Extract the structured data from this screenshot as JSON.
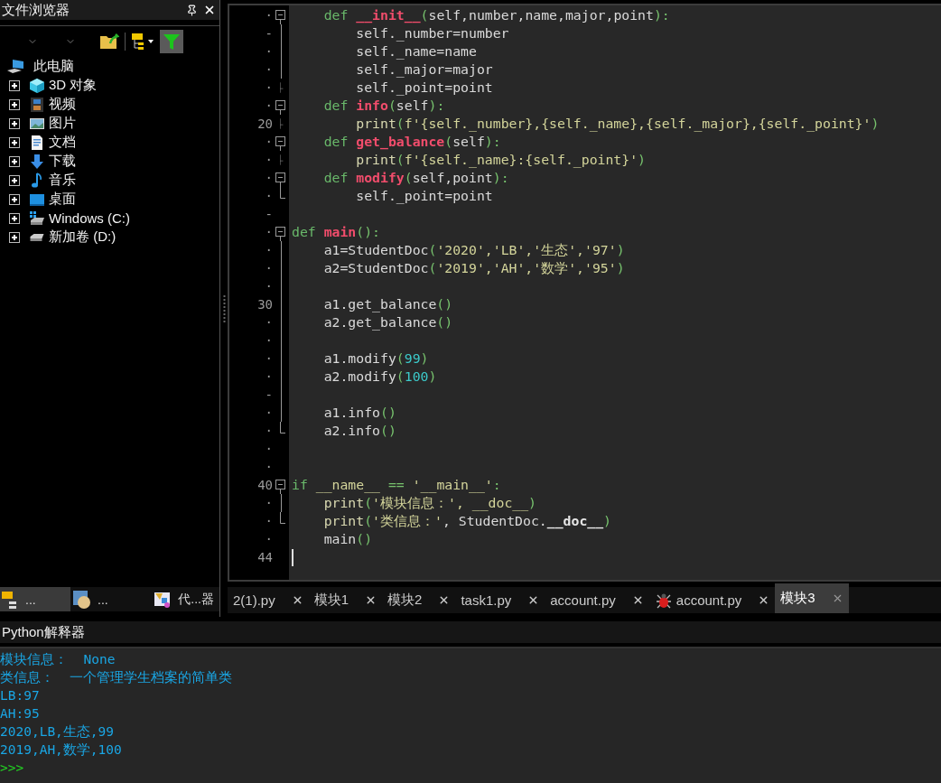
{
  "explorer": {
    "title": "文件浏览器",
    "toolbar": {
      "filter_active": true
    },
    "tree": {
      "label": "此电脑",
      "children": [
        {
          "label": "3D 对象",
          "kind": "cube",
          "expanded": false
        },
        {
          "label": "视频",
          "kind": "video",
          "expanded": false
        },
        {
          "label": "图片",
          "kind": "picture",
          "expanded": false
        },
        {
          "label": "文档",
          "kind": "document",
          "expanded": false
        },
        {
          "label": "下载",
          "kind": "download",
          "expanded": false
        },
        {
          "label": "音乐",
          "kind": "music",
          "expanded": false
        },
        {
          "label": "桌面",
          "kind": "desktop",
          "expanded": false
        },
        {
          "label": "Windows (C:)",
          "kind": "system-drive",
          "expanded": false
        },
        {
          "label": "新加卷 (D:)",
          "kind": "drive",
          "expanded": false
        }
      ]
    },
    "tabs": [
      {
        "label": "...",
        "kind": "files",
        "selected": true
      },
      {
        "label": "...",
        "kind": "classes",
        "selected": false
      },
      {
        "label": "代...器",
        "kind": "code",
        "selected": false
      }
    ]
  },
  "editor": {
    "lines": [
      {
        "gutter": "·",
        "kind": "open",
        "tokens": [
          {
            "kind": "kw",
            "text": "    def "
          },
          {
            "kind": "fn",
            "text": "__init__"
          },
          {
            "kind": "punct",
            "text": "("
          },
          {
            "kind": "text",
            "text": "self,number,name,major,point"
          },
          {
            "kind": "punct",
            "text": "):"
          }
        ]
      },
      {
        "gutter": "-",
        "kind": "line",
        "tokens": [
          {
            "kind": "text",
            "text": "        self._number=number"
          }
        ]
      },
      {
        "gutter": "·",
        "kind": "line",
        "tokens": [
          {
            "kind": "text",
            "text": "        self._name=name"
          }
        ]
      },
      {
        "gutter": "·",
        "kind": "line",
        "tokens": [
          {
            "kind": "text",
            "text": "        self._major=major"
          }
        ]
      },
      {
        "gutter": "·",
        "kind": "branch",
        "tokens": [
          {
            "kind": "text",
            "text": "        self._point=point"
          }
        ]
      },
      {
        "gutter": "·",
        "kind": "open",
        "tokens": [
          {
            "kind": "kw",
            "text": "    def "
          },
          {
            "kind": "fn",
            "text": "info"
          },
          {
            "kind": "punct",
            "text": "("
          },
          {
            "kind": "text",
            "text": "self"
          },
          {
            "kind": "punct",
            "text": "):"
          }
        ]
      },
      {
        "gutter": "20",
        "kind": "branch",
        "tokens": [
          {
            "kind": "builtin",
            "text": "        print"
          },
          {
            "kind": "punct",
            "text": "("
          },
          {
            "kind": "str",
            "text": "f'{self._number},{self._name},{self._major},{self._point}'"
          },
          {
            "kind": "punct",
            "text": ")"
          }
        ]
      },
      {
        "gutter": "·",
        "kind": "open",
        "tokens": [
          {
            "kind": "kw",
            "text": "    def "
          },
          {
            "kind": "fn",
            "text": "get_balance"
          },
          {
            "kind": "punct",
            "text": "("
          },
          {
            "kind": "text",
            "text": "self"
          },
          {
            "kind": "punct",
            "text": "):"
          }
        ]
      },
      {
        "gutter": "·",
        "kind": "branch",
        "tokens": [
          {
            "kind": "builtin",
            "text": "        print"
          },
          {
            "kind": "punct",
            "text": "("
          },
          {
            "kind": "str",
            "text": "f'{self._name}:{self._point}'"
          },
          {
            "kind": "punct",
            "text": ")"
          }
        ]
      },
      {
        "gutter": "·",
        "kind": "open",
        "tokens": [
          {
            "kind": "kw",
            "text": "    def "
          },
          {
            "kind": "fn",
            "text": "modify"
          },
          {
            "kind": "punct",
            "text": "("
          },
          {
            "kind": "text",
            "text": "self,point"
          },
          {
            "kind": "punct",
            "text": "):"
          }
        ]
      },
      {
        "gutter": "·",
        "kind": "end",
        "tokens": [
          {
            "kind": "text",
            "text": "        self._point=point"
          }
        ]
      },
      {
        "gutter": "-",
        "kind": "none"
      },
      {
        "gutter": "·",
        "kind": "open",
        "tokens": [
          {
            "kind": "kw",
            "text": "def "
          },
          {
            "kind": "fn",
            "text": "main"
          },
          {
            "kind": "punct",
            "text": "():"
          }
        ]
      },
      {
        "gutter": "·",
        "kind": "line",
        "tokens": [
          {
            "kind": "text",
            "text": "    a1=StudentDoc"
          },
          {
            "kind": "punct",
            "text": "("
          },
          {
            "kind": "str",
            "text": "'2020','LB','生态','97'"
          },
          {
            "kind": "punct",
            "text": ")"
          }
        ]
      },
      {
        "gutter": "·",
        "kind": "line",
        "tokens": [
          {
            "kind": "text",
            "text": "    a2=StudentDoc"
          },
          {
            "kind": "punct",
            "text": "("
          },
          {
            "kind": "str",
            "text": "'2019','AH','数学','95'"
          },
          {
            "kind": "punct",
            "text": ")"
          }
        ]
      },
      {
        "gutter": "·",
        "kind": "line"
      },
      {
        "gutter": "30",
        "kind": "line",
        "tokens": [
          {
            "kind": "text",
            "text": "    a1.get_balance"
          },
          {
            "kind": "punct",
            "text": "()"
          }
        ]
      },
      {
        "gutter": "·",
        "kind": "line",
        "tokens": [
          {
            "kind": "text",
            "text": "    a2.get_balance"
          },
          {
            "kind": "punct",
            "text": "()"
          }
        ]
      },
      {
        "gutter": "·",
        "kind": "line"
      },
      {
        "gutter": "·",
        "kind": "line",
        "tokens": [
          {
            "kind": "text",
            "text": "    a1.modify"
          },
          {
            "kind": "punct",
            "text": "("
          },
          {
            "kind": "num",
            "text": "99"
          },
          {
            "kind": "punct",
            "text": ")"
          }
        ]
      },
      {
        "gutter": "·",
        "kind": "line",
        "tokens": [
          {
            "kind": "text",
            "text": "    a2.modify"
          },
          {
            "kind": "punct",
            "text": "("
          },
          {
            "kind": "num",
            "text": "100"
          },
          {
            "kind": "punct",
            "text": ")"
          }
        ]
      },
      {
        "gutter": "-",
        "kind": "line"
      },
      {
        "gutter": "·",
        "kind": "line",
        "tokens": [
          {
            "kind": "text",
            "text": "    a1.info"
          },
          {
            "kind": "punct",
            "text": "()"
          }
        ]
      },
      {
        "gutter": "·",
        "kind": "end",
        "tokens": [
          {
            "kind": "text",
            "text": "    a2.info"
          },
          {
            "kind": "punct",
            "text": "()"
          }
        ]
      },
      {
        "gutter": "·",
        "kind": "none"
      },
      {
        "gutter": "·",
        "kind": "none"
      },
      {
        "gutter": "40",
        "kind": "open",
        "tokens": [
          {
            "kind": "kw",
            "text": "if "
          },
          {
            "kind": "str",
            "text": "__name__"
          },
          {
            "kind": "punct",
            "text": " == "
          },
          {
            "kind": "str",
            "text": "'__main__'"
          },
          {
            "kind": "punct",
            "text": ":"
          }
        ]
      },
      {
        "gutter": "·",
        "kind": "line",
        "tokens": [
          {
            "kind": "builtin",
            "text": "    print"
          },
          {
            "kind": "punct",
            "text": "("
          },
          {
            "kind": "str",
            "text": "'模块信息：', __doc__"
          },
          {
            "kind": "punct",
            "text": ")"
          }
        ]
      },
      {
        "gutter": "·",
        "kind": "end",
        "tokens": [
          {
            "kind": "builtin",
            "text": "    print"
          },
          {
            "kind": "punct",
            "text": "("
          },
          {
            "kind": "str",
            "text": "'类信息：'"
          },
          {
            "kind": "text",
            "text": ", StudentDoc."
          },
          {
            "kind": "dunder",
            "text": "__doc__"
          },
          {
            "kind": "punct",
            "text": ")"
          }
        ]
      },
      {
        "gutter": "·",
        "kind": "none",
        "tokens": [
          {
            "kind": "text",
            "text": "    main"
          },
          {
            "kind": "punct",
            "text": "()"
          }
        ]
      },
      {
        "gutter": "44",
        "kind": "none",
        "cursor": true
      }
    ],
    "tabs": [
      {
        "label": "2(1).py",
        "kind": "file",
        "selected": false
      },
      {
        "label": "模块1",
        "kind": "file",
        "selected": false
      },
      {
        "label": "模块2",
        "kind": "file",
        "selected": false
      },
      {
        "label": "task1.py",
        "kind": "file",
        "selected": false
      },
      {
        "label": "account.py",
        "kind": "file",
        "selected": false
      },
      {
        "label": "account.py",
        "kind": "debug",
        "selected": false
      },
      {
        "label": "模块3",
        "kind": "file",
        "selected": true
      }
    ]
  },
  "console": {
    "title": "Python解释器",
    "lines": [
      {
        "kind": "output",
        "text": "模块信息：  None"
      },
      {
        "kind": "output",
        "text": "类信息：  一个管理学生档案的简单类"
      },
      {
        "kind": "output",
        "text": "LB:97"
      },
      {
        "kind": "output",
        "text": "AH:95"
      },
      {
        "kind": "output",
        "text": "2020,LB,生态,99"
      },
      {
        "kind": "output",
        "text": "2019,AH,数学,100"
      },
      {
        "kind": "prompt",
        "text": ">>>"
      }
    ]
  }
}
